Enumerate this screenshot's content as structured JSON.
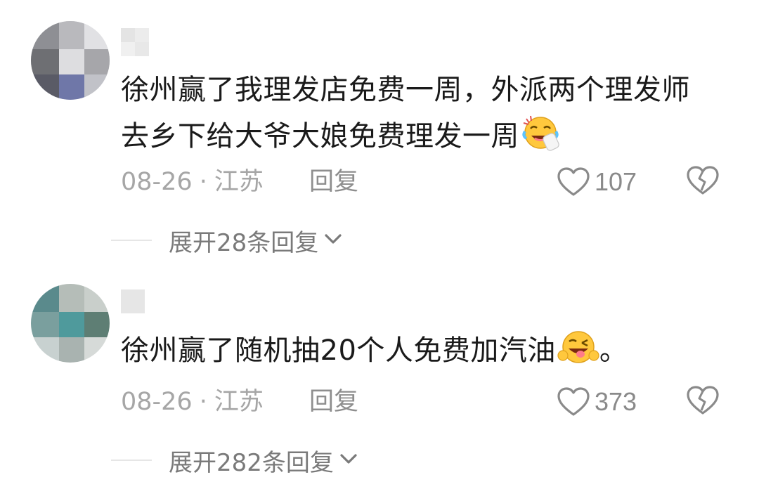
{
  "comments": [
    {
      "content_lines": [
        "徐州赢了我理发店免费一周，外派两个理发师",
        "去乡下给大爷大娘免费理发一周"
      ],
      "trailing_emoji": "laughing-crying-emoji",
      "date": "08-26",
      "separator": "·",
      "location": "江苏",
      "reply_label": "回复",
      "likes": "107",
      "expand_label": "展开28条回复"
    },
    {
      "content_lines": [
        "徐州赢了随机抽20个人免费加汽油"
      ],
      "trailing_emoji": "winking-tongue-emoji",
      "trailing_text": "。",
      "date": "08-26",
      "separator": "·",
      "location": "江苏",
      "reply_label": "回复",
      "likes": "373",
      "expand_label": "展开282条回复"
    }
  ],
  "colors": {
    "text": "#1a1a1a",
    "meta": "#a6a6a6",
    "icon": "#8a8a8a",
    "emoji_yellow": "#ffc83d"
  },
  "icons": {
    "like": "heart-outline-icon",
    "dislike": "broken-heart-icon",
    "expand": "chevron-down-icon"
  }
}
